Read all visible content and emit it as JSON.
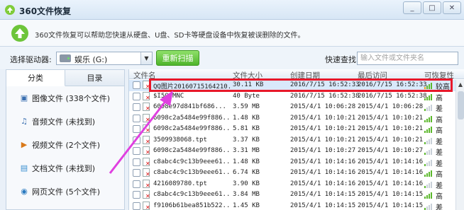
{
  "window": {
    "title": "360文件恢复",
    "minimize_glyph": "_",
    "maximize_glyph": "□",
    "close_glyph": "✕"
  },
  "info": {
    "text": "360文件恢复可以帮助您快速从硬盘、U盘、SD卡等硬盘设备中恢复被误删除的文件。"
  },
  "toolbar": {
    "drive_label": "选择驱动器:",
    "drive_value": "娱乐 (G:)",
    "rescan_label": "重新扫描",
    "quick_search_label": "快速查找:",
    "quick_search_placeholder": "输入文件或文件夹名"
  },
  "left_panel": {
    "tabs": [
      "分类",
      "目录"
    ],
    "categories": [
      {
        "label": "图像文件 (338个文件)",
        "icon": "image-icon"
      },
      {
        "label": "音频文件 (未找到)",
        "icon": "music-icon"
      },
      {
        "label": "视频文件 (2个文件)",
        "icon": "video-icon"
      },
      {
        "label": "文档文件 (未找到)",
        "icon": "document-icon"
      },
      {
        "label": "网页文件 (5个文件)",
        "icon": "webpage-icon"
      }
    ]
  },
  "table": {
    "headers": [
      "文件名",
      "文件大小",
      "创建日期",
      "最后访问",
      "可恢复性"
    ],
    "rows": [
      {
        "name": "QQ图片20160715164210.jpg",
        "size": "30.11 KB",
        "created": "2016/7/15 16:52:33",
        "accessed": "2016/7/15 16:52:33",
        "quality": "较高"
      },
      {
        "name": "$I5Q0MNC",
        "size": "40 Byte",
        "created": "2016/7/15 16:52:38",
        "accessed": "2016/7/15 16:52:38",
        "quality": "高"
      },
      {
        "name": "6098e97d841bf686...",
        "size": "3.59 MB",
        "created": "2015/4/1 10:06:28",
        "accessed": "2015/4/1 10:06:28",
        "quality": "差"
      },
      {
        "name": "6098c2a5484e99f886...",
        "size": "1.48 KB",
        "created": "2015/4/1 10:10:21",
        "accessed": "2015/4/1 10:10:21",
        "quality": "高"
      },
      {
        "name": "6098c2a5484e99f886...",
        "size": "5.81 KB",
        "created": "2015/4/1 10:10:21",
        "accessed": "2015/4/1 10:10:21",
        "quality": "高"
      },
      {
        "name": "3509938068.tpt",
        "size": "3.37 KB",
        "created": "2015/4/1 10:10:21",
        "accessed": "2015/4/1 10:10:21",
        "quality": "差"
      },
      {
        "name": "6098c2a5484e99f886...",
        "size": "3.31 MB",
        "created": "2015/4/1 10:10:27",
        "accessed": "2015/4/1 10:10:27",
        "quality": "差"
      },
      {
        "name": "c8abc4c9c13b9eee61...",
        "size": "1.48 KB",
        "created": "2015/4/1 10:14:16",
        "accessed": "2015/4/1 10:14:16",
        "quality": "差"
      },
      {
        "name": "c8abc4c9c13b9eee61...",
        "size": "6.74 KB",
        "created": "2015/4/1 10:14:16",
        "accessed": "2015/4/1 10:14:16",
        "quality": "高"
      },
      {
        "name": "4216089780.tpt",
        "size": "3.90 KB",
        "created": "2015/4/1 10:14:16",
        "accessed": "2015/4/1 10:14:16",
        "quality": "差"
      },
      {
        "name": "c8abc4c9c13b9eee61...",
        "size": "3.84 MB",
        "created": "2015/4/1 10:14:15",
        "accessed": "2015/4/1 10:14:15",
        "quality": "高"
      },
      {
        "name": "f9106b61bea851b522...",
        "size": "1.45 KB",
        "created": "2015/4/1 10:14:15",
        "accessed": "2015/4/1 10:14:15",
        "quality": "差"
      }
    ]
  },
  "colors": {
    "accent_green": "#4fb52b",
    "highlight_red": "#e8182a",
    "arrow_magenta": "#e040e0"
  }
}
